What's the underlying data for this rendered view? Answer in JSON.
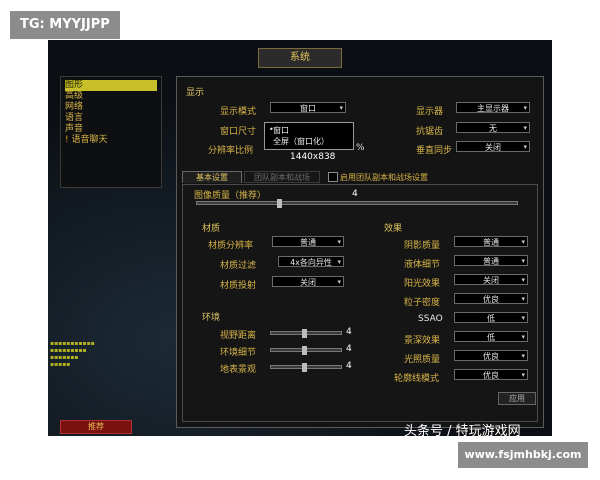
{
  "watermark_tag": "TG: MYYJJPP",
  "watermark_site": "www.fsjmhbkj.com",
  "watermark_brand": "头条号 / 特玩游戏网",
  "window_title": "系统",
  "nav": {
    "items": [
      "图形",
      "高级",
      "网络",
      "语言",
      "声音",
      "语音聊天"
    ]
  },
  "display": {
    "section_title": "显示",
    "display_mode_label": "显示模式",
    "display_mode_value": "窗口",
    "window_size_label": "窗口尺寸",
    "window_size_options": [
      "窗口",
      "全屏（窗口化）"
    ],
    "resolution_scale_label": "分辨率比例",
    "resolution_scale_pct": "%",
    "resolution_value": "1440x838",
    "monitor_label": "显示器",
    "monitor_value": "主显示器",
    "antialias_label": "抗锯齿",
    "antialias_value": "无",
    "vsync_label": "垂直同步",
    "vsync_value": "关闭"
  },
  "tabs": {
    "basic": "基本设置",
    "raid": "团队副本和战场",
    "enable_raid_label": "启用团队副本和战场设置"
  },
  "quality": {
    "label": "图像质量（推荐）",
    "value": "4",
    "level_fraction": 0.25
  },
  "texture": {
    "section_title": "材质",
    "resolution_label": "材质分辨率",
    "resolution_value": "普通",
    "filter_label": "材质过滤",
    "filter_value": "4x各向异性",
    "projection_label": "材质投射",
    "projection_value": "关闭"
  },
  "environment": {
    "section_title": "环境",
    "view_distance_label": "视野距离",
    "view_distance_value": "4",
    "env_detail_label": "环境细节",
    "env_detail_value": "4",
    "ground_clutter_label": "地表景观",
    "ground_clutter_value": "4"
  },
  "effects": {
    "section_title": "效果",
    "shadow_label": "阴影质量",
    "shadow_value": "普通",
    "liquid_label": "液体细节",
    "liquid_value": "普通",
    "sunshaft_label": "阳光效果",
    "sunshaft_value": "关闭",
    "particle_label": "粒子密度",
    "particle_value": "优良",
    "ssao_label": "SSAO",
    "ssao_value": "低",
    "dof_label": "景深效果",
    "dof_value": "低",
    "lighting_label": "光照质量",
    "lighting_value": "优良",
    "outline_label": "轮廓线模式",
    "outline_value": "优良"
  },
  "buttons": {
    "recommend": "推荐",
    "apply": "应用"
  }
}
